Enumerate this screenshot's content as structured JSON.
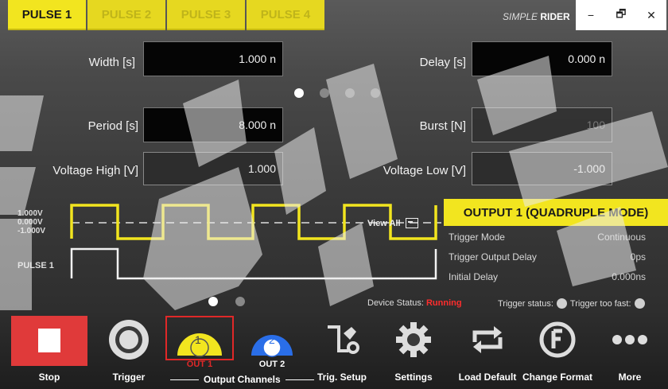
{
  "tabs": [
    {
      "label": "PULSE 1",
      "active": true
    },
    {
      "label": "PULSE 2",
      "active": false
    },
    {
      "label": "PULSE 3",
      "active": false
    },
    {
      "label": "PULSE 4",
      "active": false
    }
  ],
  "brand": {
    "prefix": "SIMPLE",
    "name": "RIDER"
  },
  "window_controls": [
    "−",
    "🗗",
    "✕"
  ],
  "fields": {
    "width": {
      "label": "Width [s]",
      "value": "1.000 n"
    },
    "delay": {
      "label": "Delay [s]",
      "value": "0.000 n"
    },
    "period": {
      "label": "Period [s]",
      "value": "8.000 n"
    },
    "burst": {
      "label": "Burst [N]",
      "value": "100"
    },
    "voltage_high": {
      "label": "Voltage High [V]",
      "value": "1.000"
    },
    "voltage_low": {
      "label": "Voltage Low [V]",
      "value": "-1.000"
    }
  },
  "pager_top": {
    "count": 4,
    "active": 0
  },
  "pager_bottom": {
    "count": 2,
    "active": 0
  },
  "waveform": {
    "labels": [
      "1.000V",
      "0.000V",
      "-1.000V"
    ],
    "pulse_label": "PULSE 1",
    "view_all": "View All"
  },
  "info_panel": {
    "title": "OUTPUT 1 (QUADRUPLE MODE)",
    "rows": [
      {
        "key": "Trigger Mode",
        "value": "Continuous"
      },
      {
        "key": "Trigger Output Delay",
        "value": "0ps"
      },
      {
        "key": "Initial Delay",
        "value": "0.000ns"
      }
    ]
  },
  "status": {
    "device_label": "Device Status:",
    "device_value": "Running",
    "trigger_status": "Trigger status:",
    "trigger_fast": "Trigger too fast:"
  },
  "toolbar": {
    "stop": "Stop",
    "trigger": "Trigger",
    "out1": "OUT 1",
    "out1_num": "1",
    "out2": "OUT 2",
    "out2_num": "2",
    "output_channels": "Output Channels",
    "trig_setup": "Trig. Setup",
    "settings": "Settings",
    "load_default": "Load Default",
    "change_format": "Change Format",
    "more": "More"
  },
  "colors": {
    "accent_yellow": "#f2e51f",
    "stop_red": "#e03a3a",
    "out2_blue": "#2a6ee8",
    "running_red": "#ff2d2d"
  }
}
